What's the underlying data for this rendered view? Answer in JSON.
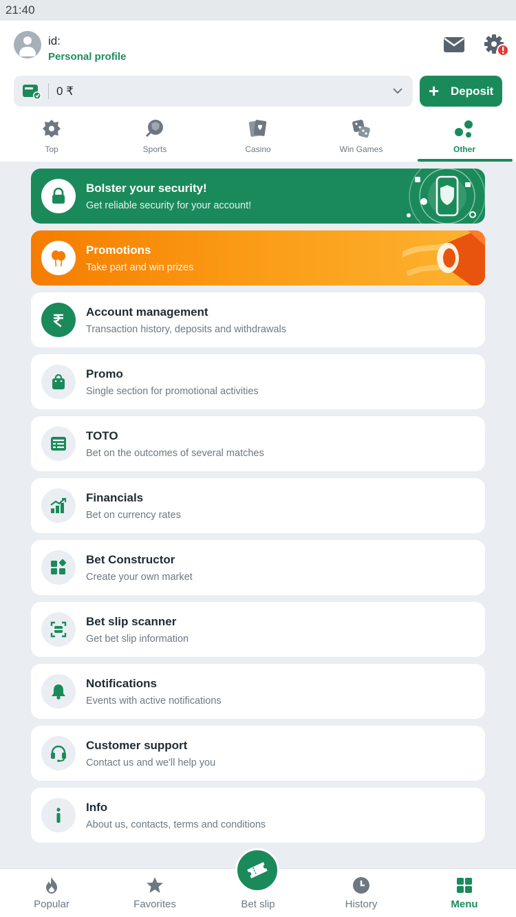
{
  "status_bar": {
    "time": "21:40"
  },
  "profile": {
    "id_label": "id:",
    "link": "Personal profile"
  },
  "balance": {
    "amount": "0 ₹"
  },
  "deposit": {
    "label": "Deposit"
  },
  "tabs": [
    {
      "label": "Top",
      "icon": "gear-badge-icon"
    },
    {
      "label": "Sports",
      "icon": "ball-icon"
    },
    {
      "label": "Casino",
      "icon": "cards-icon"
    },
    {
      "label": "Win Games",
      "icon": "dice-icon"
    },
    {
      "label": "Other",
      "icon": "dots-icon",
      "active": true
    }
  ],
  "cards": {
    "security": {
      "title": "Bolster your security!",
      "subtitle": "Get reliable security for your account!",
      "icon": "lock-icon"
    },
    "promotions": {
      "title": "Promotions",
      "subtitle": "Take part and win prizes",
      "icon": "balloons-icon"
    },
    "account": {
      "title": "Account management",
      "subtitle": "Transaction history, deposits and withdrawals",
      "icon": "rupee-icon"
    },
    "promo": {
      "title": "Promo",
      "subtitle": "Single section for promotional activities",
      "icon": "shopping-bag-icon"
    },
    "toto": {
      "title": "TOTO",
      "subtitle": "Bet on the outcomes of several matches",
      "icon": "toto-list-icon"
    },
    "financials": {
      "title": "Financials",
      "subtitle": "Bet on currency rates",
      "icon": "chart-icon"
    },
    "constructor": {
      "title": "Bet Constructor",
      "subtitle": "Create your own market",
      "icon": "blocks-icon"
    },
    "scanner": {
      "title": "Bet slip scanner",
      "subtitle": "Get bet slip information",
      "icon": "scan-icon"
    },
    "notifications": {
      "title": "Notifications",
      "subtitle": "Events with active notifications",
      "icon": "bell-icon"
    },
    "support": {
      "title": "Customer support",
      "subtitle": "Contact us and we'll help you",
      "icon": "headset-icon"
    },
    "info": {
      "title": "Info",
      "subtitle": "About us, contacts, terms and conditions",
      "icon": "info-icon"
    }
  },
  "bottom_nav": [
    {
      "label": "Popular",
      "icon": "flame-icon"
    },
    {
      "label": "Favorites",
      "icon": "star-icon"
    },
    {
      "label": "Bet slip",
      "icon": "ticket-icon"
    },
    {
      "label": "History",
      "icon": "clock-icon"
    },
    {
      "label": "Menu",
      "icon": "grid-icon",
      "active": true
    }
  ],
  "colors": {
    "brand_green": "#1b8a5b",
    "accent_orange": "#f57c00",
    "alert_red": "#e53935"
  }
}
